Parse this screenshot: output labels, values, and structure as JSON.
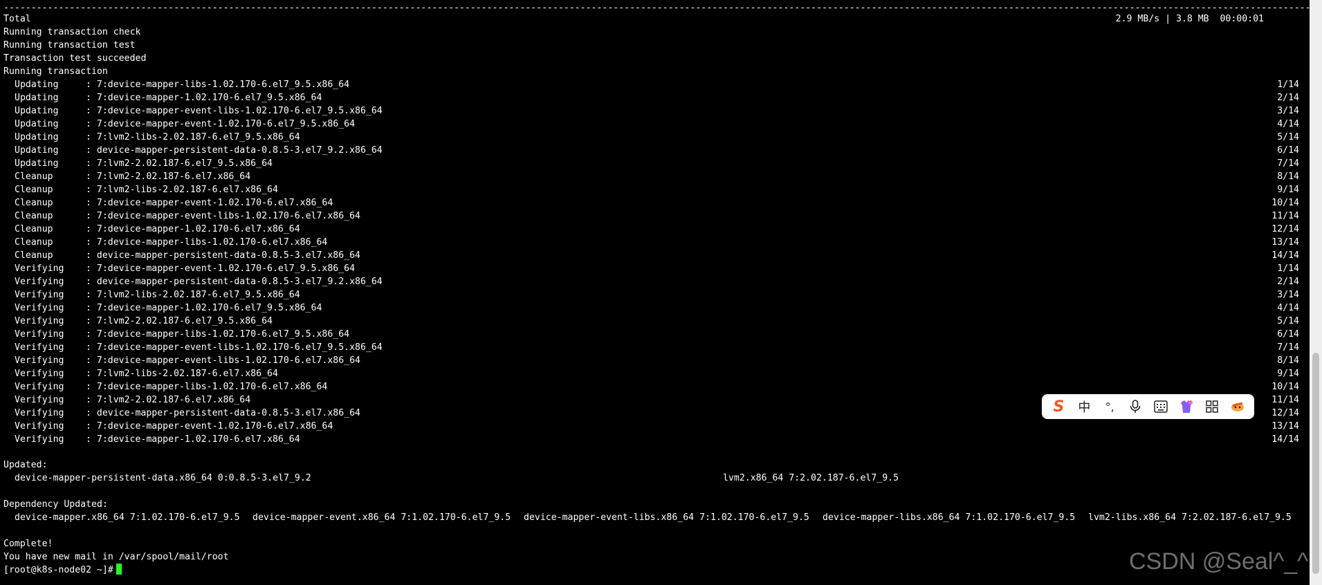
{
  "terminal": {
    "separator": "-----------------------------------------------------------------------------------------------------------------------------------------------------------------------------------------------------------------------------------------------------------------------",
    "total": {
      "label": "Total",
      "stats": "2.9 MB/s | 3.8 MB  00:00:01"
    },
    "preamble": [
      "Running transaction check",
      "Running transaction test",
      "Transaction test succeeded",
      "Running transaction"
    ],
    "steps": [
      {
        "action": "Updating",
        "package": ": 7:device-mapper-libs-1.02.170-6.el7_9.5.x86_64",
        "progress": "1/14"
      },
      {
        "action": "Updating",
        "package": ": 7:device-mapper-1.02.170-6.el7_9.5.x86_64",
        "progress": "2/14"
      },
      {
        "action": "Updating",
        "package": ": 7:device-mapper-event-libs-1.02.170-6.el7_9.5.x86_64",
        "progress": "3/14"
      },
      {
        "action": "Updating",
        "package": ": 7:device-mapper-event-1.02.170-6.el7_9.5.x86_64",
        "progress": "4/14"
      },
      {
        "action": "Updating",
        "package": ": 7:lvm2-libs-2.02.187-6.el7_9.5.x86_64",
        "progress": "5/14"
      },
      {
        "action": "Updating",
        "package": ": device-mapper-persistent-data-0.8.5-3.el7_9.2.x86_64",
        "progress": "6/14"
      },
      {
        "action": "Updating",
        "package": ": 7:lvm2-2.02.187-6.el7_9.5.x86_64",
        "progress": "7/14"
      },
      {
        "action": "Cleanup",
        "package": ": 7:lvm2-2.02.187-6.el7.x86_64",
        "progress": "8/14"
      },
      {
        "action": "Cleanup",
        "package": ": 7:lvm2-libs-2.02.187-6.el7.x86_64",
        "progress": "9/14"
      },
      {
        "action": "Cleanup",
        "package": ": 7:device-mapper-event-1.02.170-6.el7.x86_64",
        "progress": "10/14"
      },
      {
        "action": "Cleanup",
        "package": ": 7:device-mapper-event-libs-1.02.170-6.el7.x86_64",
        "progress": "11/14"
      },
      {
        "action": "Cleanup",
        "package": ": 7:device-mapper-1.02.170-6.el7.x86_64",
        "progress": "12/14"
      },
      {
        "action": "Cleanup",
        "package": ": 7:device-mapper-libs-1.02.170-6.el7.x86_64",
        "progress": "13/14"
      },
      {
        "action": "Cleanup",
        "package": ": device-mapper-persistent-data-0.8.5-3.el7.x86_64",
        "progress": "14/14"
      },
      {
        "action": "Verifying",
        "package": ": 7:device-mapper-event-1.02.170-6.el7_9.5.x86_64",
        "progress": "1/14"
      },
      {
        "action": "Verifying",
        "package": ": device-mapper-persistent-data-0.8.5-3.el7_9.2.x86_64",
        "progress": "2/14"
      },
      {
        "action": "Verifying",
        "package": ": 7:lvm2-libs-2.02.187-6.el7_9.5.x86_64",
        "progress": "3/14"
      },
      {
        "action": "Verifying",
        "package": ": 7:device-mapper-1.02.170-6.el7_9.5.x86_64",
        "progress": "4/14"
      },
      {
        "action": "Verifying",
        "package": ": 7:lvm2-2.02.187-6.el7_9.5.x86_64",
        "progress": "5/14"
      },
      {
        "action": "Verifying",
        "package": ": 7:device-mapper-libs-1.02.170-6.el7_9.5.x86_64",
        "progress": "6/14"
      },
      {
        "action": "Verifying",
        "package": ": 7:device-mapper-event-libs-1.02.170-6.el7_9.5.x86_64",
        "progress": "7/14"
      },
      {
        "action": "Verifying",
        "package": ": 7:device-mapper-event-libs-1.02.170-6.el7.x86_64",
        "progress": "8/14"
      },
      {
        "action": "Verifying",
        "package": ": 7:lvm2-libs-2.02.187-6.el7.x86_64",
        "progress": "9/14"
      },
      {
        "action": "Verifying",
        "package": ": 7:device-mapper-libs-1.02.170-6.el7.x86_64",
        "progress": "10/14"
      },
      {
        "action": "Verifying",
        "package": ": 7:lvm2-2.02.187-6.el7.x86_64",
        "progress": "11/14"
      },
      {
        "action": "Verifying",
        "package": ": device-mapper-persistent-data-0.8.5-3.el7.x86_64",
        "progress": "12/14"
      },
      {
        "action": "Verifying",
        "package": ": 7:device-mapper-event-1.02.170-6.el7.x86_64",
        "progress": "13/14"
      },
      {
        "action": "Verifying",
        "package": ": 7:device-mapper-1.02.170-6.el7.x86_64",
        "progress": "14/14"
      }
    ],
    "updated": {
      "heading": "Updated:",
      "packages": [
        "device-mapper-persistent-data.x86_64 0:0.8.5-3.el7_9.2",
        "lvm2.x86_64 7:2.02.187-6.el7_9.5"
      ]
    },
    "dependency_updated": {
      "heading": "Dependency Updated:",
      "packages": [
        "device-mapper.x86_64 7:1.02.170-6.el7_9.5",
        "device-mapper-event.x86_64 7:1.02.170-6.el7_9.5",
        "device-mapper-event-libs.x86_64 7:1.02.170-6.el7_9.5",
        "device-mapper-libs.x86_64 7:1.02.170-6.el7_9.5",
        "lvm2-libs.x86_64 7:2.02.187-6.el7_9.5"
      ]
    },
    "complete": "Complete!",
    "mail_notice": "You have new mail in /var/spool/mail/root",
    "prompt": "[root@k8s-node02 ~]#"
  },
  "ime_toolbar": {
    "logo_glyph": "S",
    "mode_glyph": "中",
    "punct_glyph": "°,",
    "icons": [
      "sogou-logo-icon",
      "chinese-mode-icon",
      "punctuation-icon",
      "microphone-icon",
      "keyboard-icon",
      "skin-icon",
      "apps-grid-icon",
      "toolbox-icon"
    ]
  },
  "watermark": "CSDN @Seal^_^",
  "colors": {
    "background": "#000000",
    "text": "#ffffff",
    "cursor": "#22ff22",
    "ime_accent": "#e85a1f"
  }
}
